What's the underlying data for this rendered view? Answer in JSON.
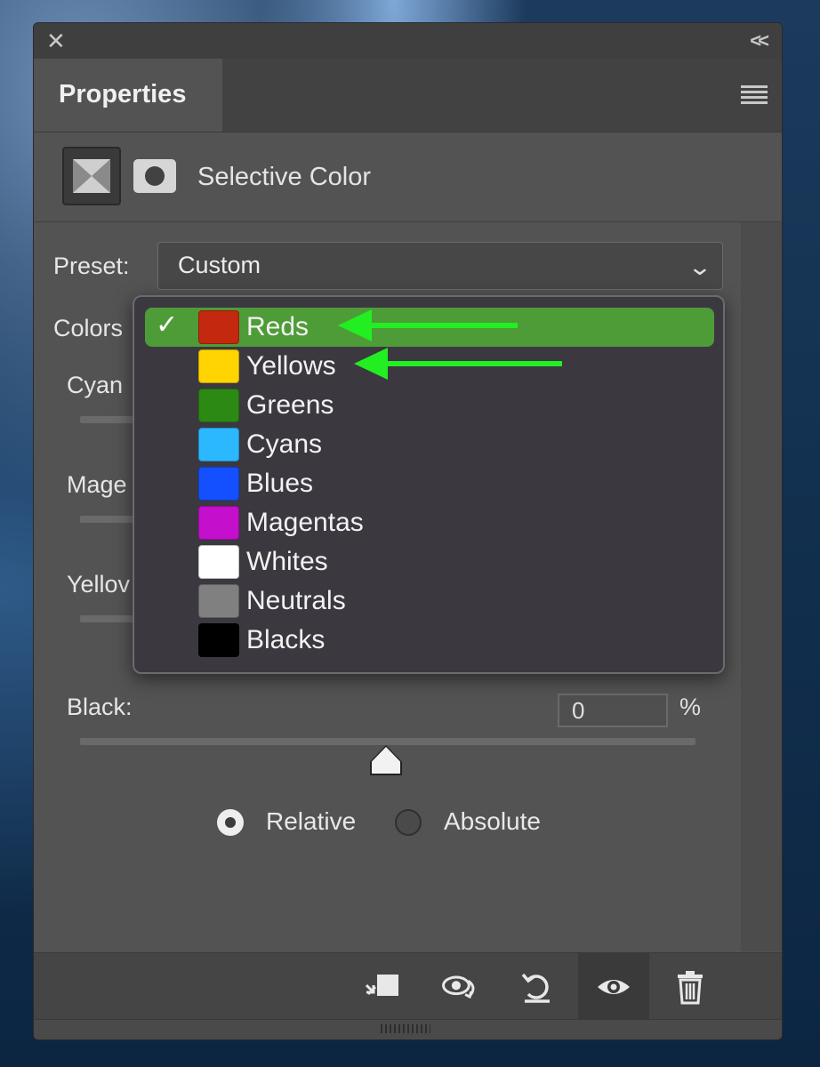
{
  "panel": {
    "close_glyph": "✕",
    "collapse_glyph": "<<",
    "tab_title": "Properties",
    "adjustment_title": "Selective Color"
  },
  "preset": {
    "label": "Preset:",
    "value": "Custom"
  },
  "colors": {
    "label": "Colors",
    "selected": "Reds",
    "options": [
      {
        "label": "Reds",
        "swatch": "#c4280e",
        "checked": true
      },
      {
        "label": "Yellows",
        "swatch": "#ffd400",
        "checked": false
      },
      {
        "label": "Greens",
        "swatch": "#2c8a14",
        "checked": false
      },
      {
        "label": "Cyans",
        "swatch": "#2cb8ff",
        "checked": false
      },
      {
        "label": "Blues",
        "swatch": "#1450ff",
        "checked": false
      },
      {
        "label": "Magentas",
        "swatch": "#c40fcc",
        "checked": false
      },
      {
        "label": "Whites",
        "swatch": "#ffffff",
        "checked": false
      },
      {
        "label": "Neutrals",
        "swatch": "#808080",
        "checked": false
      },
      {
        "label": "Blacks",
        "swatch": "#000000",
        "checked": false
      }
    ]
  },
  "sliders": {
    "cyan_label": "Cyan",
    "magenta_label": "Mage",
    "yellow_label": "Yellov",
    "black_label": "Black:",
    "black_value": "0",
    "percent": "%"
  },
  "method": {
    "relative_label": "Relative",
    "absolute_label": "Absolute",
    "selected": "Relative"
  },
  "bottom_icons": [
    "clip-to-layer-icon",
    "view-previous-state-icon",
    "reset-icon",
    "visibility-eye-icon",
    "trash-icon"
  ],
  "annotation_color": "#22ee22",
  "selected_highlight_color": "#4e9c38"
}
